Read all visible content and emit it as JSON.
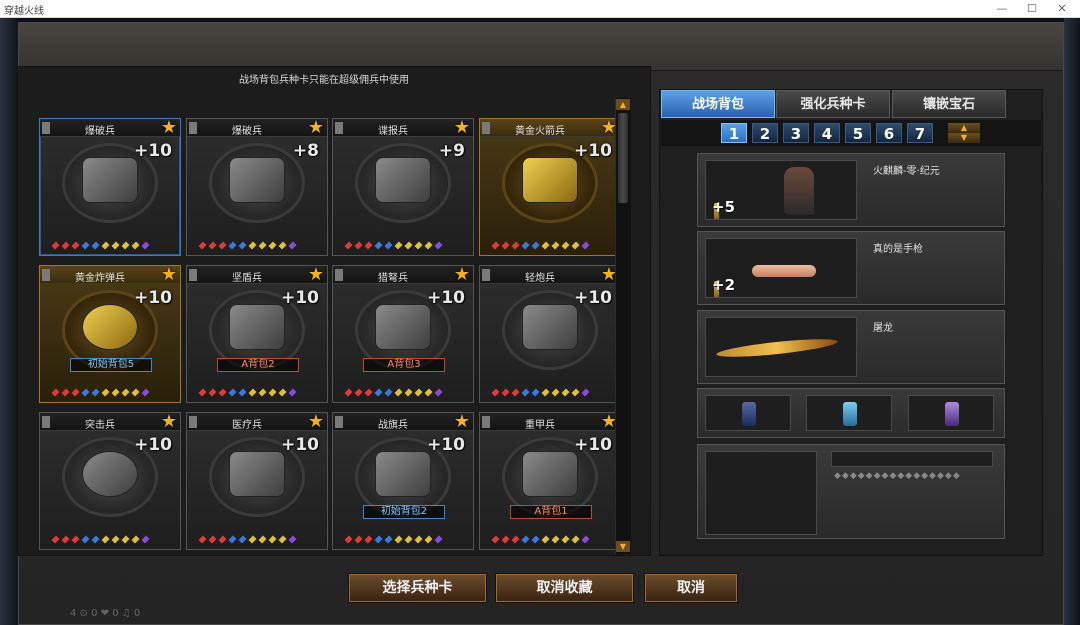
{
  "window": {
    "title": "穿越火线",
    "min": "—",
    "max": "☐",
    "close": "✕"
  },
  "notice": "战场背包兵种卡只能在超级佣兵中使用",
  "cards": [
    {
      "name": "爆破兵",
      "plus": "+10",
      "tag": ""
    },
    {
      "name": "爆破兵",
      "plus": "+8",
      "tag": ""
    },
    {
      "name": "谍报兵",
      "plus": "+9",
      "tag": ""
    },
    {
      "name": "黄金火箭兵",
      "plus": "+10",
      "tag": ""
    },
    {
      "name": "黄金炸弹兵",
      "plus": "+10",
      "tag": "初始背包5"
    },
    {
      "name": "坚盾兵",
      "plus": "+10",
      "tag": "A背包2"
    },
    {
      "name": "猎弩兵",
      "plus": "+10",
      "tag": "A背包3"
    },
    {
      "name": "轻炮兵",
      "plus": "+10",
      "tag": ""
    },
    {
      "name": "突击兵",
      "plus": "+10",
      "tag": ""
    },
    {
      "name": "医疗兵",
      "plus": "+10",
      "tag": ""
    },
    {
      "name": "战旗兵",
      "plus": "+10",
      "tag": "初始背包2"
    },
    {
      "name": "重甲兵",
      "plus": "+10",
      "tag": "A背包1"
    }
  ],
  "tabs": [
    "战场背包",
    "强化兵种卡",
    "镶嵌宝石"
  ],
  "pages": [
    "1",
    "2",
    "3",
    "4",
    "5",
    "6",
    "7"
  ],
  "slots": [
    {
      "name": "火麒麟-零·纪元",
      "count": "+5"
    },
    {
      "name": "真的是手枪",
      "count": "+2"
    },
    {
      "name": "屠龙",
      "count": ""
    }
  ],
  "bs_dots": "◆◆◆◆◆◆◆◆◆◆◆◆◆◆◆◆",
  "buttons": {
    "select": "选择兵种卡",
    "unfav": "取消收藏",
    "cancel": "取消"
  },
  "status": "4 ⊙   0 ❤   0 ♫   0",
  "colors": {
    "accent": "#2a70c0",
    "gold": "#f3b21a",
    "button": "#6a4c2c"
  },
  "icons": {
    "star": "★",
    "up": "▲",
    "down": "▼"
  }
}
